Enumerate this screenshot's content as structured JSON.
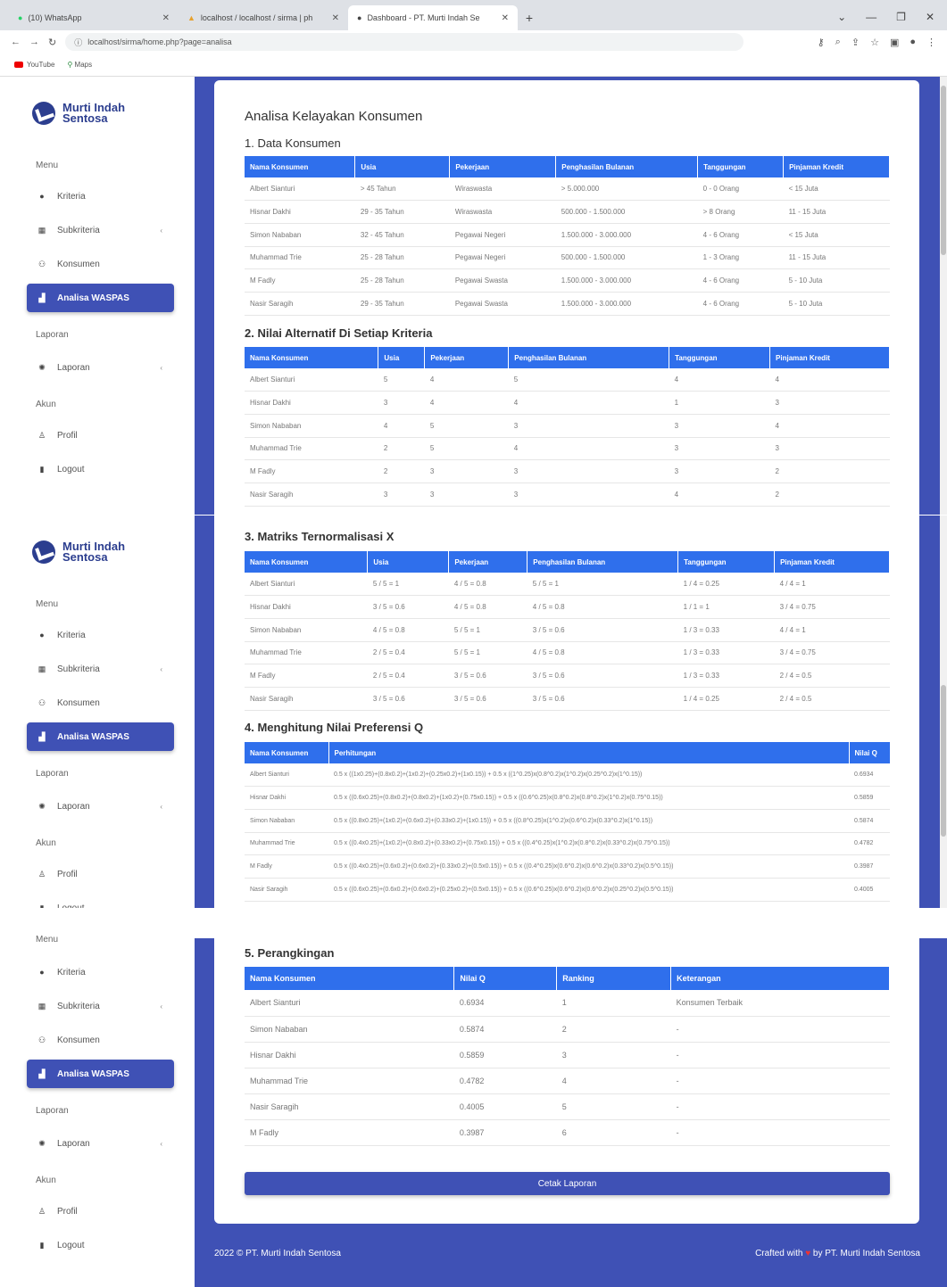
{
  "browser": {
    "tabs": [
      {
        "label": "(10) WhatsApp"
      },
      {
        "label": "localhost / localhost / sirma | ph"
      },
      {
        "label": "Dashboard - PT. Murti Indah Se"
      }
    ],
    "url": "localhost/sirma/home.php?page=analisa",
    "bookmarks": [
      "YouTube",
      "Maps"
    ]
  },
  "brand": {
    "line1": "Murti Indah",
    "line2": "Sentosa"
  },
  "sidebar": {
    "menu_header": "Menu",
    "items": [
      {
        "label": "Kriteria",
        "icon": "dot-icon"
      },
      {
        "label": "Subkriteria",
        "icon": "table-icon"
      },
      {
        "label": "Konsumen",
        "icon": "users-icon"
      },
      {
        "label": "Analisa WASPAS",
        "icon": "chart-icon"
      }
    ],
    "laporan_header": "Laporan",
    "laporan_item": "Laporan",
    "akun_header": "Akun",
    "akun_items": [
      "Profil",
      "Logout"
    ]
  },
  "page": {
    "title": "Analisa Kelayakan Konsumen"
  },
  "section1": {
    "title": "1. Data Konsumen",
    "headers": [
      "Nama Konsumen",
      "Usia",
      "Pekerjaan",
      "Penghasilan Bulanan",
      "Tanggungan",
      "Pinjaman Kredit"
    ],
    "rows": [
      [
        "Albert Sianturi",
        "> 45 Tahun",
        "Wiraswasta",
        "> 5.000.000",
        "0 - 0 Orang",
        "< 15 Juta"
      ],
      [
        "Hisnar Dakhi",
        "29 - 35 Tahun",
        "Wiraswasta",
        "500.000 - 1.500.000",
        "> 8 Orang",
        "11 - 15 Juta"
      ],
      [
        "Simon Nababan",
        "32 - 45 Tahun",
        "Pegawai Negeri",
        "1.500.000 - 3.000.000",
        "4 - 6 Orang",
        "< 15 Juta"
      ],
      [
        "Muhammad Trie",
        "25 - 28 Tahun",
        "Pegawai Negeri",
        "500.000 - 1.500.000",
        "1 - 3 Orang",
        "11 - 15 Juta"
      ],
      [
        "M Fadly",
        "25 - 28 Tahun",
        "Pegawai Swasta",
        "1.500.000 - 3.000.000",
        "4 - 6 Orang",
        "5 - 10 Juta"
      ],
      [
        "Nasir Saragih",
        "29 - 35 Tahun",
        "Pegawai Swasta",
        "1.500.000 - 3.000.000",
        "4 - 6 Orang",
        "5 - 10 Juta"
      ]
    ]
  },
  "section2": {
    "title": "2. Nilai Alternatif Di Setiap Kriteria",
    "headers": [
      "Nama Konsumen",
      "Usia",
      "Pekerjaan",
      "Penghasilan Bulanan",
      "Tanggungan",
      "Pinjaman Kredit"
    ],
    "rows": [
      [
        "Albert Sianturi",
        "5",
        "4",
        "5",
        "4",
        "4"
      ],
      [
        "Hisnar Dakhi",
        "3",
        "4",
        "4",
        "1",
        "3"
      ],
      [
        "Simon Nababan",
        "4",
        "5",
        "3",
        "3",
        "4"
      ],
      [
        "Muhammad Trie",
        "2",
        "5",
        "4",
        "3",
        "3"
      ],
      [
        "M Fadly",
        "2",
        "3",
        "3",
        "3",
        "2"
      ],
      [
        "Nasir Saragih",
        "3",
        "3",
        "3",
        "4",
        "2"
      ]
    ]
  },
  "section3": {
    "title": "3. Matriks Ternormalisasi X",
    "headers": [
      "Nama Konsumen",
      "Usia",
      "Pekerjaan",
      "Penghasilan Bulanan",
      "Tanggungan",
      "Pinjaman Kredit"
    ],
    "rows": [
      [
        "Albert Sianturi",
        "5 / 5 = 1",
        "4 / 5 = 0.8",
        "5 / 5 = 1",
        "1 / 4 = 0.25",
        "4 / 4 = 1"
      ],
      [
        "Hisnar Dakhi",
        "3 / 5 = 0.6",
        "4 / 5 = 0.8",
        "4 / 5 = 0.8",
        "1 / 1 = 1",
        "3 / 4 = 0.75"
      ],
      [
        "Simon Nababan",
        "4 / 5 = 0.8",
        "5 / 5 = 1",
        "3 / 5 = 0.6",
        "1 / 3 = 0.33",
        "4 / 4 = 1"
      ],
      [
        "Muhammad Trie",
        "2 / 5 = 0.4",
        "5 / 5 = 1",
        "4 / 5 = 0.8",
        "1 / 3 = 0.33",
        "3 / 4 = 0.75"
      ],
      [
        "M Fadly",
        "2 / 5 = 0.4",
        "3 / 5 = 0.6",
        "3 / 5 = 0.6",
        "1 / 3 = 0.33",
        "2 / 4 = 0.5"
      ],
      [
        "Nasir Saragih",
        "3 / 5 = 0.6",
        "3 / 5 = 0.6",
        "3 / 5 = 0.6",
        "1 / 4 = 0.25",
        "2 / 4 = 0.5"
      ]
    ]
  },
  "section4": {
    "title": "4. Menghitung Nilai Preferensi Q",
    "headers": [
      "Nama Konsumen",
      "Perhitungan",
      "Nilai Q"
    ],
    "rows": [
      [
        "Albert Sianturi",
        "0.5 x ((1x0.25)+(0.8x0.2)+(1x0.2)+(0.25x0.2)+(1x0.15)) + 0.5 x ((1^0.25)x(0.8^0.2)x(1^0.2)x(0.25^0.2)x(1^0.15))",
        "0.6934"
      ],
      [
        "Hisnar Dakhi",
        "0.5 x ((0.6x0.25)+(0.8x0.2)+(0.8x0.2)+(1x0.2)+(0.75x0.15)) + 0.5 x ((0.6^0.25)x(0.8^0.2)x(0.8^0.2)x(1^0.2)x(0.75^0.15))",
        "0.5859"
      ],
      [
        "Simon Nababan",
        "0.5 x ((0.8x0.25)+(1x0.2)+(0.6x0.2)+(0.33x0.2)+(1x0.15)) + 0.5 x ((0.8^0.25)x(1^0.2)x(0.6^0.2)x(0.33^0.2)x(1^0.15))",
        "0.5874"
      ],
      [
        "Muhammad Trie",
        "0.5 x ((0.4x0.25)+(1x0.2)+(0.8x0.2)+(0.33x0.2)+(0.75x0.15)) + 0.5 x ((0.4^0.25)x(1^0.2)x(0.8^0.2)x(0.33^0.2)x(0.75^0.15))",
        "0.4782"
      ],
      [
        "M Fadly",
        "0.5 x ((0.4x0.25)+(0.6x0.2)+(0.6x0.2)+(0.33x0.2)+(0.5x0.15)) + 0.5 x ((0.4^0.25)x(0.6^0.2)x(0.6^0.2)x(0.33^0.2)x(0.5^0.15))",
        "0.3987"
      ],
      [
        "Nasir Saragih",
        "0.5 x ((0.6x0.25)+(0.6x0.2)+(0.6x0.2)+(0.25x0.2)+(0.5x0.15)) + 0.5 x ((0.6^0.25)x(0.6^0.2)x(0.6^0.2)x(0.25^0.2)x(0.5^0.15))",
        "0.4005"
      ]
    ]
  },
  "section5": {
    "title": "5. Perangkingan",
    "headers": [
      "Nama Konsumen",
      "Nilai Q",
      "Ranking",
      "Keterangan"
    ],
    "rows": [
      [
        "Albert Sianturi",
        "0.6934",
        "1",
        "Konsumen Terbaik"
      ],
      [
        "Simon Nababan",
        "0.5874",
        "2",
        "-"
      ],
      [
        "Hisnar Dakhi",
        "0.5859",
        "3",
        "-"
      ],
      [
        "Muhammad Trie",
        "0.4782",
        "4",
        "-"
      ],
      [
        "Nasir Saragih",
        "0.4005",
        "5",
        "-"
      ],
      [
        "M Fadly",
        "0.3987",
        "6",
        "-"
      ]
    ],
    "print_button": "Cetak Laporan"
  },
  "footer": {
    "left": "2022 © PT. Murti Indah Sentosa",
    "right_a": "Crafted with",
    "right_b": "by PT. Murti Indah Sentosa"
  },
  "colors": {
    "primary": "#3f51b5",
    "table_header": "#2f6fec"
  }
}
